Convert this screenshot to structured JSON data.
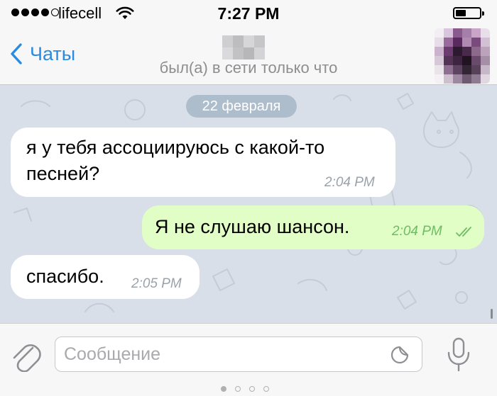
{
  "status_bar": {
    "carrier": "lifecell",
    "time": "7:27 PM",
    "signal_bars": 4,
    "battery_level": 0.35
  },
  "nav": {
    "back_label": "Чаты",
    "last_seen": "был(а) в сети только что"
  },
  "chat": {
    "date": "22 февраля",
    "messages": [
      {
        "direction": "incoming",
        "line1": "я у тебя ассоциируюсь с какой-то",
        "line2": "песней?",
        "time": "2:04 PM"
      },
      {
        "direction": "outgoing",
        "text": "Я не слушаю шансон.",
        "time": "2:04 PM",
        "read": true
      },
      {
        "direction": "incoming",
        "text": "спасибо.",
        "time": "2:05 PM"
      }
    ]
  },
  "input": {
    "placeholder": "Сообщение",
    "value": ""
  },
  "colors": {
    "accent": "#2a8be0",
    "chat_background": "#d8dfe8",
    "outgoing_bubble": "#e1fec6",
    "incoming_bubble": "#ffffff",
    "read_check": "#6dbd62"
  },
  "icons": [
    "chevron-left-icon",
    "wifi-icon",
    "battery-icon",
    "paperclip-icon",
    "sticker-icon",
    "microphone-icon",
    "double-check-icon"
  ]
}
